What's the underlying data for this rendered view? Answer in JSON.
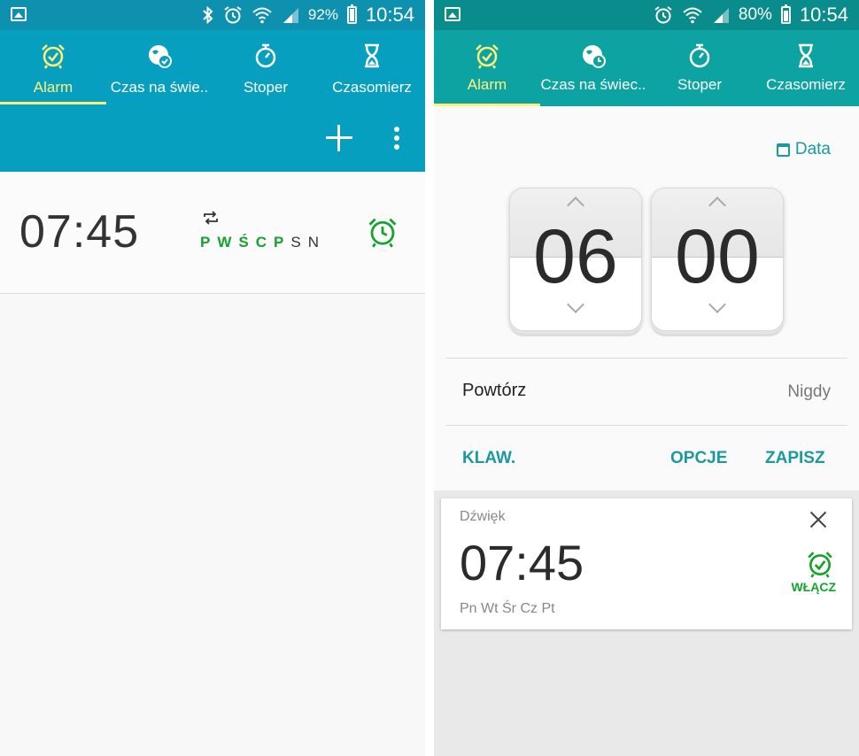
{
  "colors": {
    "left_header": "#079fc0",
    "right_header": "#0da3a3",
    "active_tab": "#fff27a",
    "enabled_day": "#17a22f",
    "action_text": "#1a9aa0"
  },
  "left": {
    "status": {
      "battery": "92%",
      "time": "10:54",
      "battery_level": 0.92
    },
    "tabs": [
      {
        "label": "Alarm",
        "icon": "alarm-clock-icon"
      },
      {
        "label": "Czas na świe..",
        "icon": "world-clock-icon"
      },
      {
        "label": "Stoper",
        "icon": "stopwatch-icon"
      },
      {
        "label": "Czasomierz",
        "icon": "hourglass-icon"
      }
    ],
    "actions": {
      "add_icon": "plus-icon",
      "menu_icon": "more-vert-icon"
    },
    "alarm": {
      "time": "07:45",
      "days": [
        {
          "label": "P",
          "enabled": true
        },
        {
          "label": "W",
          "enabled": true
        },
        {
          "label": "Ś",
          "enabled": true
        },
        {
          "label": "C",
          "enabled": true
        },
        {
          "label": "P",
          "enabled": true
        },
        {
          "label": "S",
          "enabled": false
        },
        {
          "label": "N",
          "enabled": false
        }
      ]
    }
  },
  "right": {
    "status": {
      "battery": "80%",
      "time": "10:54",
      "battery_level": 0.8
    },
    "tabs": [
      {
        "label": "Alarm",
        "icon": "alarm-clock-icon"
      },
      {
        "label": "Czas na świec..",
        "icon": "world-clock-icon"
      },
      {
        "label": "Stoper",
        "icon": "stopwatch-icon"
      },
      {
        "label": "Czasomierz",
        "icon": "hourglass-icon"
      }
    ],
    "editor": {
      "date_label": "Data",
      "hours": "06",
      "minutes": "00",
      "repeat_label": "Powtórz",
      "repeat_value": "Nigdy",
      "keyboard_button": "KLAW.",
      "options_button": "OPCJE",
      "save_button": "ZAPISZ"
    },
    "card": {
      "sound_label": "Dźwięk",
      "time": "07:45",
      "days": "Pn Wt Śr Cz Pt",
      "enable_label": "WŁĄCZ"
    }
  }
}
